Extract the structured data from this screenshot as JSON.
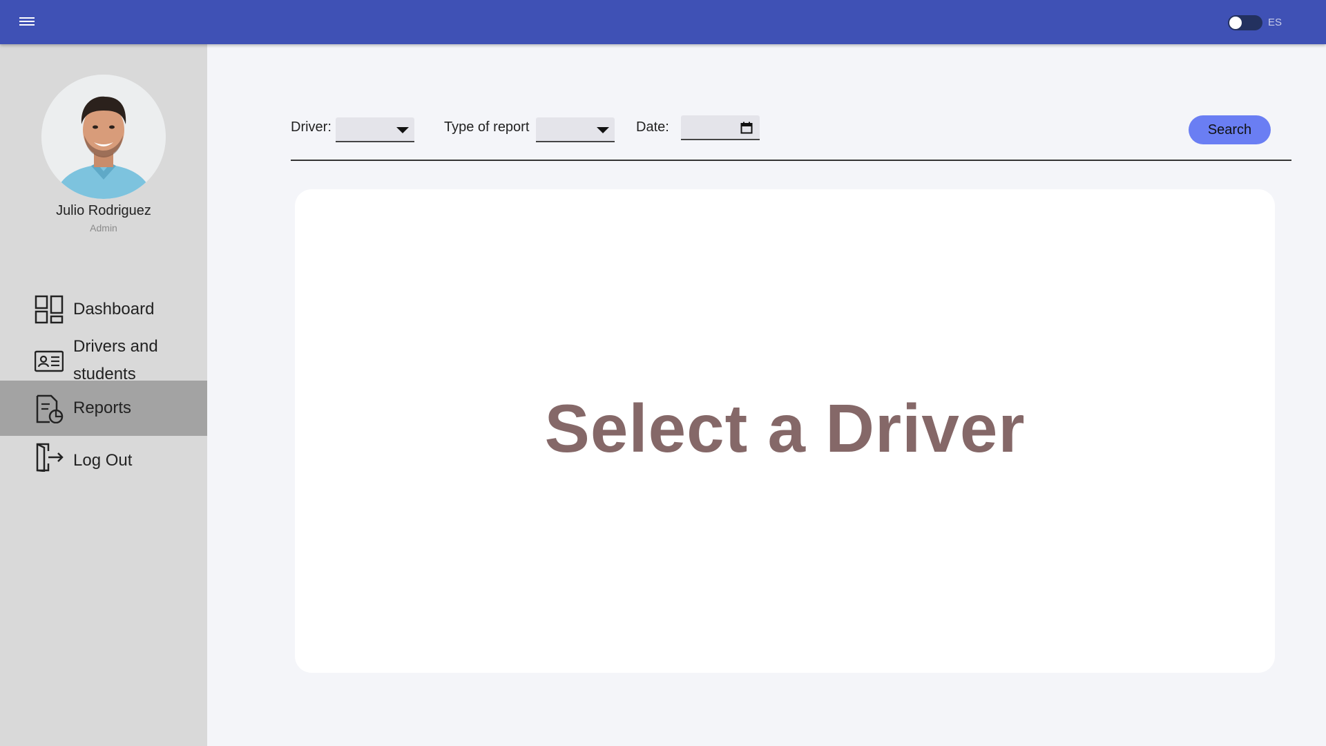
{
  "app": {
    "language": "ES"
  },
  "user": {
    "name": "Julio Rodriguez",
    "role": "Admin"
  },
  "sidebar": {
    "items": [
      {
        "label": "Dashboard",
        "icon": "dashboard-icon",
        "active": false
      },
      {
        "label": "Drivers and students",
        "icon": "id-card-icon",
        "active": false
      },
      {
        "label": "Reports",
        "icon": "report-icon",
        "active": true
      },
      {
        "label": "Log Out",
        "icon": "logout-icon",
        "active": false
      }
    ]
  },
  "filters": {
    "driver_label": "Driver:",
    "driver_value": "",
    "report_type_label": "Type of report",
    "report_type_value": "",
    "date_label": "Date:",
    "date_value": "",
    "search_label": "Search"
  },
  "main": {
    "message": "Select a Driver"
  },
  "colors": {
    "topbar": "#3f51b5",
    "sidebar": "#d9d9d9",
    "active_item": "#a3a3a3",
    "search_button": "#6a7ef3",
    "message_text": "#856868"
  }
}
